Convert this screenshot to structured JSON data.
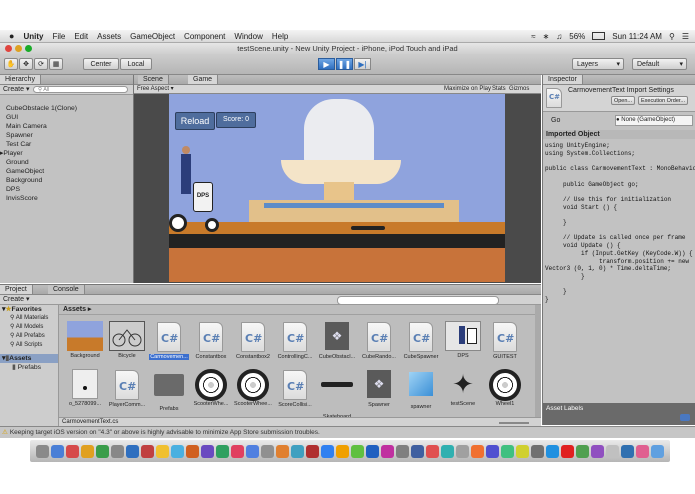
{
  "menubar": {
    "app": "Unity",
    "items": [
      "File",
      "Edit",
      "Assets",
      "GameObject",
      "Component",
      "Window",
      "Help"
    ],
    "battery": "56%",
    "clock": "Sun 11:24 AM"
  },
  "window_title": "testScene.unity - New Unity Project - iPhone, iPod Touch and iPad",
  "toolbar": {
    "center": "Center",
    "local": "Local",
    "layers": "Layers",
    "layout": "Default"
  },
  "hierarchy": {
    "tab": "Hierarchy",
    "create": "Create",
    "search": "All",
    "items": [
      "CubeObstacle 1(Clone)",
      "GUI",
      "Main Camera",
      "Spawner",
      "Test Car",
      "Player",
      "Ground",
      "GameObject",
      "Background",
      "DPS",
      "InvisScore"
    ]
  },
  "scene_tabs": {
    "scene": "Scene",
    "game": "Game"
  },
  "game_view": {
    "aspect": "Free Aspect",
    "maximize": "Maximize on Play",
    "stats": "Stats",
    "gizmos": "Gizmos",
    "reload": "Reload",
    "score": "Score: 0",
    "dps": "DPS"
  },
  "inspector": {
    "tab": "Inspector",
    "title": "CarmovementText Import Settings",
    "open": "Open...",
    "exec_order": "Execution Order...",
    "go_label": "Go",
    "go_value": "None (GameObject)",
    "imported": "Imported Object",
    "code": "using UnityEngine;\nusing System.Collections;\n\npublic class CarmovementText : MonoBehaviour {\n\n     public GameObject go;\n\n     // Use this for initialization\n     void Start () {\n\n     }\n\n     // Update is called once per frame\n     void Update () {\n          if (Input.GetKey (KeyCode.W)) {\n               transform.position += new\nVector3 (0, 1, 0) * Time.deltaTime;\n          }\n\n     }\n}",
    "asset_labels": "Asset Labels"
  },
  "project": {
    "tab": "Project",
    "console_tab": "Console",
    "create": "Create",
    "favorites": "Favorites",
    "fav_items": [
      "All Materials",
      "All Models",
      "All Prefabs",
      "All Scripts"
    ],
    "assets_root": "Assets",
    "asset_children": [
      "Prefabs"
    ],
    "breadcrumb": "Assets",
    "row1": [
      "Background",
      "Bicycle",
      "Carmovemen...",
      "Constantbox",
      "Constantbox2",
      "ControllingC...",
      "CubeObstacl...",
      "CubeRando...",
      "CubeSpawner",
      "DPS",
      "GUITEST"
    ],
    "row2": [
      "o_5278099...",
      "PlayerComm...",
      "Prefabs",
      "ScooterWhe...",
      "ScooterWhee...",
      "ScoreCollisi...",
      "Skateboard",
      "Spawner",
      "spawner",
      "testScene",
      "Wheel1"
    ],
    "selected_file": "CarmovementText.cs"
  },
  "status": "Keeping target iOS version on \"4.3\" or above is highly advisable to minimize App Store submission troubles."
}
